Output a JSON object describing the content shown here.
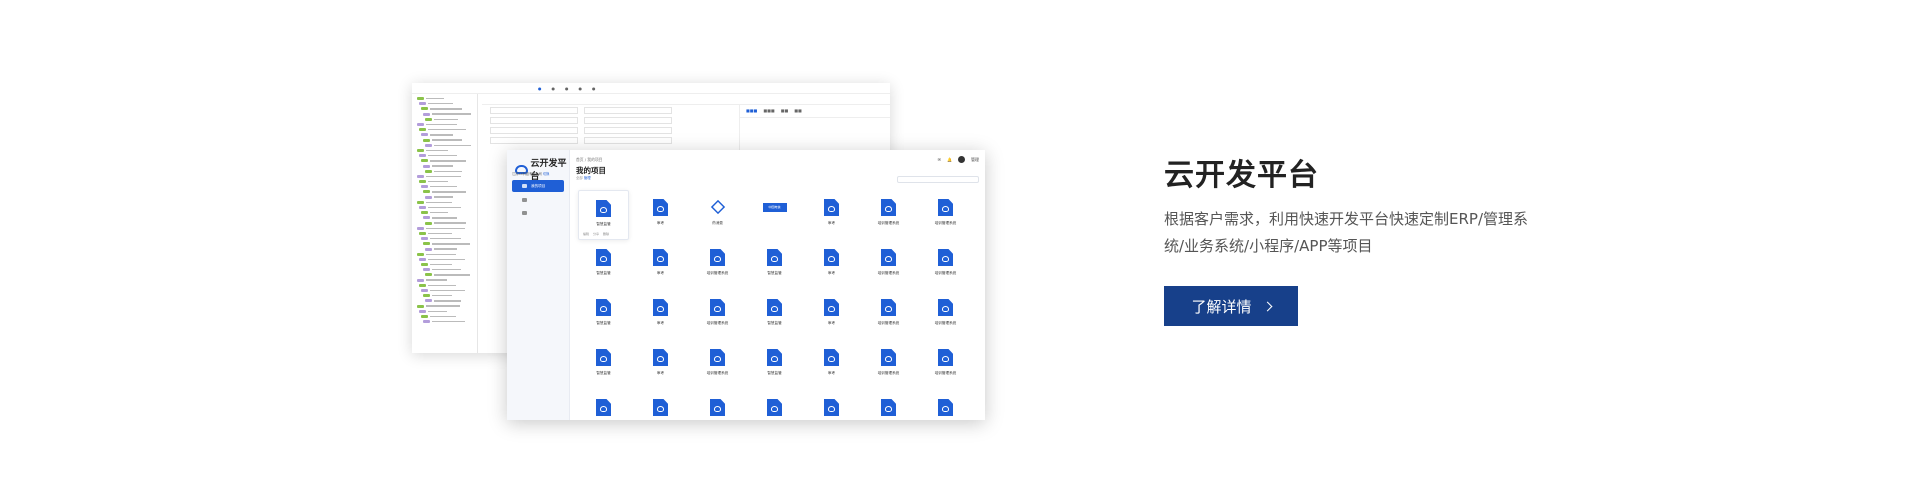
{
  "back_app": {
    "tabs": [
      "",
      "",
      "",
      "",
      ""
    ],
    "tree_rows": 44
  },
  "front_app": {
    "logo_text": "云开发平台",
    "company": "江苏XX科技有限公司",
    "company_switch": "切换",
    "nav": [
      "我的项目",
      "",
      ""
    ],
    "breadcrumb": "首页 / 我的项目",
    "page_title": "我的项目",
    "subtitle_prefix": "全部",
    "subtitle_link": "管理",
    "user_name": "管理",
    "search_placeholder": "",
    "first_card_meta": [
      "编辑",
      "分享",
      "删除"
    ],
    "projects": [
      {
        "label": "智慧监管",
        "icon": "doc"
      },
      {
        "label": "审考",
        "icon": "doc"
      },
      {
        "label": "药消费",
        "icon": "cube"
      },
      {
        "label": "",
        "icon": "brand",
        "brand_text": "中国电信"
      },
      {
        "label": "审考",
        "icon": "doc"
      },
      {
        "label": "培训管理系统",
        "icon": "doc"
      },
      {
        "label": "培训管理系统",
        "icon": "doc"
      },
      {
        "label": "智慧监管",
        "icon": "doc"
      },
      {
        "label": "审考",
        "icon": "doc"
      },
      {
        "label": "培训管理系统",
        "icon": "doc"
      },
      {
        "label": "智慧监管",
        "icon": "doc"
      },
      {
        "label": "审考",
        "icon": "doc"
      },
      {
        "label": "培训管理系统",
        "icon": "doc"
      },
      {
        "label": "培训管理系统",
        "icon": "doc"
      },
      {
        "label": "智慧监管",
        "icon": "doc"
      },
      {
        "label": "审考",
        "icon": "doc"
      },
      {
        "label": "培训管理系统",
        "icon": "doc"
      },
      {
        "label": "智慧监管",
        "icon": "doc"
      },
      {
        "label": "审考",
        "icon": "doc"
      },
      {
        "label": "培训管理系统",
        "icon": "doc"
      },
      {
        "label": "培训管理系统",
        "icon": "doc"
      },
      {
        "label": "智慧监管",
        "icon": "doc"
      },
      {
        "label": "审考",
        "icon": "doc"
      },
      {
        "label": "培训管理系统",
        "icon": "doc"
      },
      {
        "label": "智慧监管",
        "icon": "doc"
      },
      {
        "label": "审考",
        "icon": "doc"
      },
      {
        "label": "培训管理系统",
        "icon": "doc"
      },
      {
        "label": "培训管理系统",
        "icon": "doc"
      },
      {
        "label": "",
        "icon": "doc"
      },
      {
        "label": "",
        "icon": "doc"
      },
      {
        "label": "",
        "icon": "doc"
      },
      {
        "label": "",
        "icon": "doc"
      },
      {
        "label": "",
        "icon": "doc"
      },
      {
        "label": "",
        "icon": "doc"
      },
      {
        "label": "",
        "icon": "doc"
      }
    ]
  },
  "hero": {
    "title": "云开发平台",
    "description": "根据客户需求，利用快速开发平台快速定制ERP/管理系统/业务系统/小程序/APP等项目",
    "button_label": "了解详情"
  },
  "colors": {
    "primary": "#1f5fd6",
    "button": "#17408a",
    "title": "#222222",
    "text": "#555555"
  }
}
